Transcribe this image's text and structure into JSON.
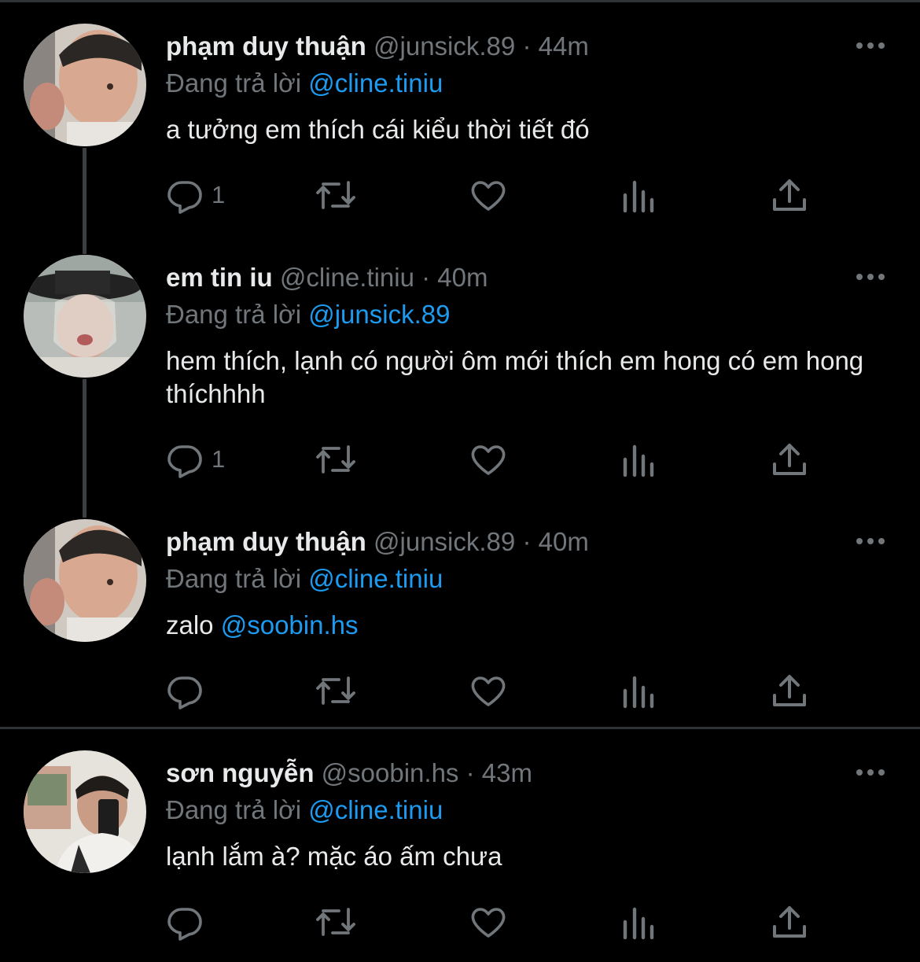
{
  "colors": {
    "background": "#000000",
    "text": "#e7e9ea",
    "muted": "#71767b",
    "mention": "#1d9bf0",
    "divider": "#2f3336"
  },
  "reply_prefix": "Đang trả lời",
  "tweets": [
    {
      "name": "phạm duy thuận",
      "handle": "@junsick.89",
      "dot": "·",
      "time": "44m",
      "reply_to": "@cline.tiniu",
      "text": "a tưởng em thích cái kiểu thời tiết đó",
      "text_mention": "",
      "reply_count": "1",
      "avatar_icon": "profile-photo"
    },
    {
      "name": "em tin iu",
      "handle": "@cline.tiniu",
      "dot": "·",
      "time": "40m",
      "reply_to": "@junsick.89",
      "text": "hem thích, lạnh có người ôm mới thích em hong có em hong thíchhhh",
      "text_mention": "",
      "reply_count": "1",
      "avatar_icon": "profile-photo"
    },
    {
      "name": "phạm duy thuận",
      "handle": "@junsick.89",
      "dot": "·",
      "time": "40m",
      "reply_to": "@cline.tiniu",
      "text": "zalo ",
      "text_mention": "@soobin.hs",
      "reply_count": "",
      "avatar_icon": "profile-photo"
    },
    {
      "name": "sơn nguyễn",
      "handle": "@soobin.hs",
      "dot": "·",
      "time": "43m",
      "reply_to": "@cline.tiniu",
      "text": "lạnh lắm à? mặc áo ấm chưa",
      "text_mention": "",
      "reply_count": "",
      "avatar_icon": "profile-photo"
    }
  ],
  "action_icons": [
    "reply-icon",
    "retweet-icon",
    "like-icon",
    "views-icon",
    "share-icon"
  ]
}
